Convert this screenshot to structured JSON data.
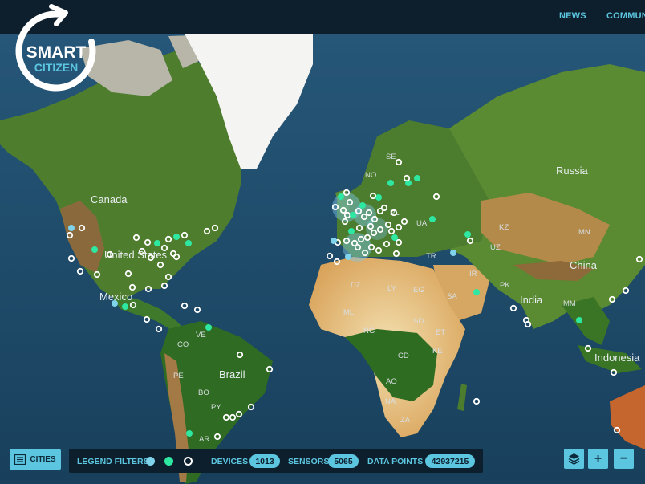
{
  "header": {
    "nav": [
      {
        "label": "NEWS"
      },
      {
        "label": "COMMUN"
      }
    ]
  },
  "logo": {
    "line1": "SMART",
    "line2": "CITIZEN"
  },
  "map": {
    "country_labels": [
      {
        "text": "Canada"
      },
      {
        "text": "United States"
      },
      {
        "text": "Mexico"
      },
      {
        "text": "Brazil"
      },
      {
        "text": "Russia"
      },
      {
        "text": "China"
      },
      {
        "text": "India"
      },
      {
        "text": "Indonesia"
      }
    ],
    "country_codes": [
      "SE",
      "NO",
      "PL",
      "UA",
      "KZ",
      "MN",
      "UZ",
      "TR",
      "IR",
      "PK",
      "SA",
      "EG",
      "LY",
      "DZ",
      "ML",
      "NG",
      "SD",
      "ET",
      "CD",
      "KE",
      "AO",
      "NA",
      "ZA",
      "MM",
      "VE",
      "CO",
      "PE",
      "BO",
      "PY",
      "AR"
    ]
  },
  "bottom": {
    "cities_label": "CITIES",
    "legend_label": "LEGEND FILTERS",
    "devices_label": "DEVICES",
    "devices_value": "1013",
    "sensors_label": "SENSORS",
    "sensors_value": "5065",
    "datapoints_label": "DATA POINTS",
    "datapoints_value": "42937215"
  },
  "controls": [
    {
      "icon": "layers-icon"
    },
    {
      "symbol": "+"
    },
    {
      "symbol": "−"
    }
  ],
  "colors": {
    "accent": "#5cc6e0",
    "online": "#2ee8a2",
    "offline_ring": "#ffffff",
    "bar_bg": "#0d1f2d"
  }
}
